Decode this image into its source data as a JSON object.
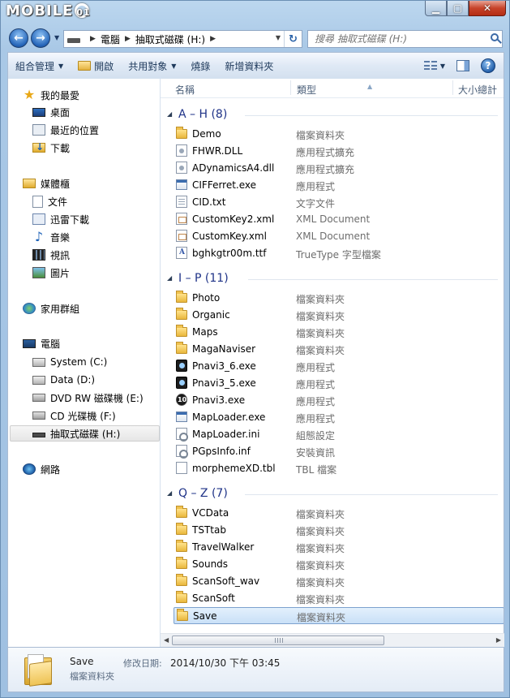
{
  "titlebar": {
    "watermark": "MOBILE",
    "watermark_suffix": "01"
  },
  "address": {
    "crumbs": [
      "電腦",
      "抽取式磁碟 (H:)"
    ],
    "search_placeholder": "搜尋 抽取式磁碟 (H:)"
  },
  "toolbar": {
    "organize": "組合管理",
    "open": "開啟",
    "share": "共用對象",
    "burn": "燒錄",
    "new_folder": "新增資料夾"
  },
  "nav": {
    "favorites": "我的最愛",
    "desktop": "桌面",
    "recent": "最近的位置",
    "downloads": "下載",
    "libraries": "媒體櫃",
    "documents": "文件",
    "thunder": "迅雷下載",
    "music": "音樂",
    "videos": "視訊",
    "pictures": "圖片",
    "homegroup": "家用群組",
    "computer": "電腦",
    "system_c": "System (C:)",
    "data_d": "Data (D:)",
    "dvd_e": "DVD RW 磁碟機 (E:)",
    "cd_f": "CD 光碟機 (F:)",
    "removable_h": "抽取式磁碟 (H:)",
    "network": "網路"
  },
  "columns": {
    "name": "名稱",
    "type": "類型",
    "size": "大小總計"
  },
  "groups": [
    {
      "title": "A – H (8)",
      "items": [
        {
          "name": "Demo",
          "type": "檔案資料夾",
          "icon": "folder-icon"
        },
        {
          "name": "FHWR.DLL",
          "type": "應用程式擴充",
          "icon": "dll-icon"
        },
        {
          "name": "ADynamicsA4.dll",
          "type": "應用程式擴充",
          "icon": "dll-icon"
        },
        {
          "name": "CIFFerret.exe",
          "type": "應用程式",
          "icon": "exe-icon"
        },
        {
          "name": "CID.txt",
          "type": "文字文件",
          "icon": "txt-icon"
        },
        {
          "name": "CustomKey2.xml",
          "type": "XML Document",
          "icon": "xml-icon"
        },
        {
          "name": "CustomKey.xml",
          "type": "XML Document",
          "icon": "xml-icon"
        },
        {
          "name": "bghkgtr00m.ttf",
          "type": "TrueType 字型檔案",
          "icon": "font-icon"
        }
      ]
    },
    {
      "title": "I – P (11)",
      "items": [
        {
          "name": "Photo",
          "type": "檔案資料夾",
          "icon": "folder-icon"
        },
        {
          "name": "Organic",
          "type": "檔案資料夾",
          "icon": "folder-icon"
        },
        {
          "name": "Maps",
          "type": "檔案資料夾",
          "icon": "folder-icon"
        },
        {
          "name": "MagaNaviser",
          "type": "檔案資料夾",
          "icon": "folder-icon"
        },
        {
          "name": "Pnavi3_6.exe",
          "type": "應用程式",
          "icon": "pnavi-icon"
        },
        {
          "name": "Pnavi3_5.exe",
          "type": "應用程式",
          "icon": "pnavi-icon"
        },
        {
          "name": "Pnavi3.exe",
          "type": "應用程式",
          "icon": "ten-icon"
        },
        {
          "name": "MapLoader.exe",
          "type": "應用程式",
          "icon": "exe-icon"
        },
        {
          "name": "MapLoader.ini",
          "type": "組態設定",
          "icon": "ini-icon"
        },
        {
          "name": "PGpsInfo.inf",
          "type": "安裝資訊",
          "icon": "ini-icon"
        },
        {
          "name": "morphemeXD.tbl",
          "type": "TBL 檔案",
          "icon": "blank-file-icon"
        }
      ]
    },
    {
      "title": "Q – Z (7)",
      "items": [
        {
          "name": "VCData",
          "type": "檔案資料夾",
          "icon": "folder-icon"
        },
        {
          "name": "TSTtab",
          "type": "檔案資料夾",
          "icon": "folder-icon"
        },
        {
          "name": "TravelWalker",
          "type": "檔案資料夾",
          "icon": "folder-icon"
        },
        {
          "name": "Sounds",
          "type": "檔案資料夾",
          "icon": "folder-icon"
        },
        {
          "name": "ScanSoft_wav",
          "type": "檔案資料夾",
          "icon": "folder-icon"
        },
        {
          "name": "ScanSoft",
          "type": "檔案資料夾",
          "icon": "folder-icon"
        },
        {
          "name": "Save",
          "type": "檔案資料夾",
          "icon": "folder-icon",
          "selected": true
        }
      ]
    }
  ],
  "details": {
    "name": "Save",
    "type": "檔案資料夾",
    "modified_label": "修改日期:",
    "modified_value": "2014/10/30 下午 03:45"
  }
}
